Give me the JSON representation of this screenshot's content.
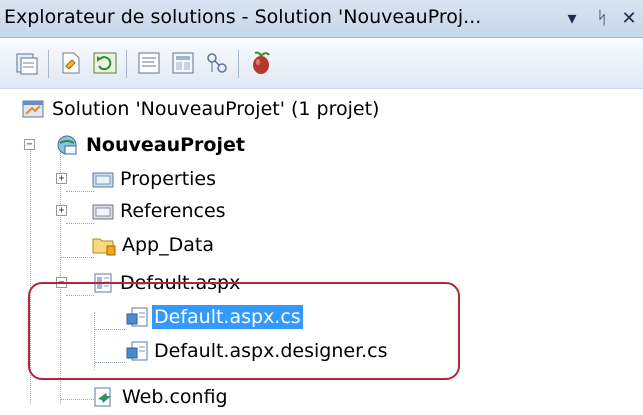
{
  "window": {
    "title": "Explorateur de solutions - Solution 'NouveauProj...",
    "dropdown_glyph": "▾",
    "pin_glyph": "ᛋ",
    "close_glyph": "✕"
  },
  "toolbar": {
    "buttons": [
      {
        "name": "properties-icon"
      },
      {
        "name": "show-all-files-icon"
      },
      {
        "name": "refresh-icon"
      },
      {
        "name": "view-code-icon"
      },
      {
        "name": "view-designer-icon"
      },
      {
        "name": "nest-related-files-icon"
      },
      {
        "name": "copy-web-site-icon"
      }
    ]
  },
  "tree": {
    "solution": "Solution 'NouveauProjet' (1 projet)",
    "project": "NouveauProjet",
    "items": {
      "properties": "Properties",
      "references": "References",
      "app_data": "App_Data",
      "default_aspx": "Default.aspx",
      "default_aspx_cs": "Default.aspx.cs",
      "default_aspx_designer": "Default.aspx.designer.cs",
      "web_config": "Web.config"
    },
    "expander_plus": "+",
    "expander_minus": "−"
  },
  "colors": {
    "selection": "#3399ff",
    "highlight_border": "#b3263a"
  }
}
